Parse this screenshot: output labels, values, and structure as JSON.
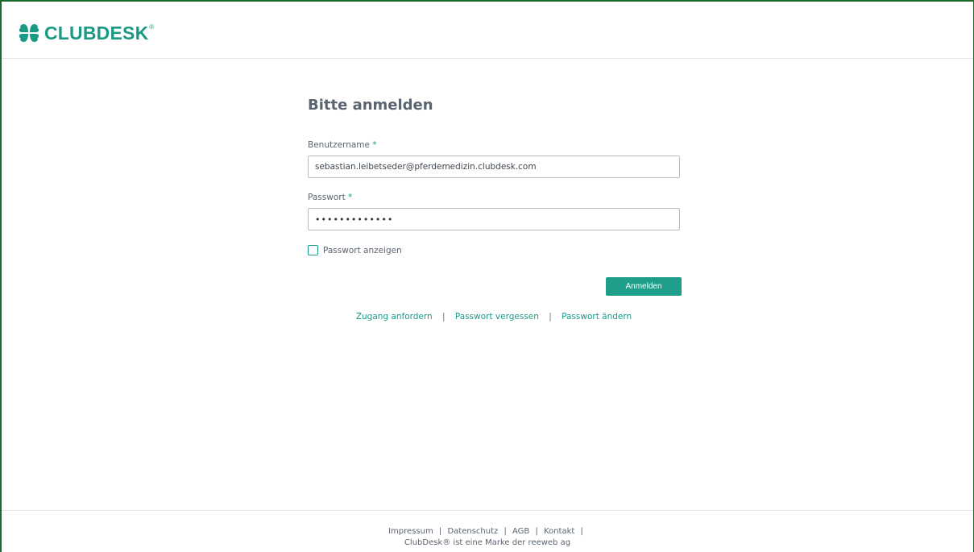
{
  "brand": {
    "name": "CLUBDESK",
    "registered_mark": "®",
    "icon": "clover-icon",
    "color": "#1a9a86"
  },
  "login": {
    "title": "Bitte anmelden",
    "username_label": "Benutzername",
    "username_value": "sebastian.leibetseder@pferdemedizin.clubdesk.com",
    "password_label": "Passwort",
    "password_masked": "•••••••••••••",
    "required_marker": "*",
    "show_password_label": "Passwort anzeigen",
    "show_password_checked": false,
    "submit_label": "Anmelden"
  },
  "links": {
    "request_access": "Zugang anfordern",
    "forgot_password": "Passwort vergessen",
    "change_password": "Passwort ändern",
    "separator": "|"
  },
  "footer": {
    "impressum": "Impressum",
    "datenschutz": "Datenschutz",
    "agb": "AGB",
    "kontakt": "Kontakt",
    "separator": "|",
    "trademark": "ClubDesk® ist eine Marke der reeweb ag"
  },
  "colors": {
    "accent": "#1f9e8a",
    "frame": "#1d6b2a",
    "text": "#5a6470"
  }
}
